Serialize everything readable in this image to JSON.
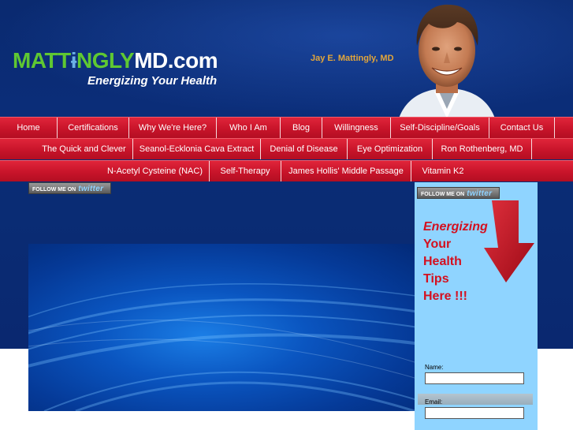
{
  "header": {
    "logo": {
      "part1": "MATT",
      "part2": "NGLY",
      "part3": "MD",
      "part4": ".com",
      "tagline": "Energizing Your Health"
    },
    "doctor_name": "Jay E. Mattingly, MD"
  },
  "nav": {
    "row1": [
      "Home",
      "Certifications",
      "Why We're Here?",
      "Who I Am",
      "Blog",
      "Willingness",
      "Self-Discipline/Goals",
      "Contact Us"
    ],
    "row2": [
      "The Quick and Clever",
      "Seanol-Ecklonia Cava Extract",
      "Denial of Disease",
      "Eye Optimization",
      "Ron Rothenberg, MD"
    ],
    "row3": [
      "N-Acetyl Cysteine (NAC)",
      "Self-Therapy",
      "James Hollis' Middle Passage",
      "Vitamin K2"
    ]
  },
  "twitter": {
    "prefix": "FOLLOW ME ON",
    "word": "twitter"
  },
  "sidebar": {
    "tips_line1": "Energizing",
    "tips_line2": "Your",
    "tips_line3": "Health",
    "tips_line4": "Tips",
    "tips_line5": "Here !!!",
    "name_label": "Name:",
    "email_label": "Email:"
  },
  "colors": {
    "nav_red": "#c8142a",
    "background_blue": "#0a2c74",
    "sidebar_blue": "#8fd4ff",
    "tips_red": "#d4101f",
    "logo_green": "#5fc832",
    "name_gold": "#e3a63a"
  }
}
